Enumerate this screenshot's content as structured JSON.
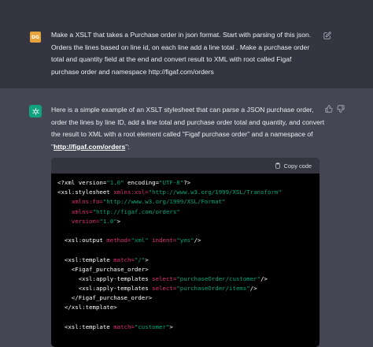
{
  "user_message": {
    "avatar_initials": "DG",
    "avatar_color": "#e6a23c",
    "text": "Make a XSLT  that takes a Purchase order in json format. Start with parsing of this json. Orders the lines based on line id, on each line add a line total . Make a purchase order total and quantity field at the end and convert result to XML with root called Figaf purchase order and namespace http://figaf.com/orders"
  },
  "assistant_message": {
    "avatar_icon": "openai-logo-icon",
    "avatar_color": "#10a37f",
    "intro_text": "Here is a simple example of an XSLT stylesheet that can parse a JSON purchase order, order the lines by line ID, add a line total and purchase order total and quantity, and convert the result to XML with a root element called \"Figaf purchase order\" and a namespace of \"",
    "link_text": "http://figaf.com/orders",
    "intro_suffix": "\":"
  },
  "code_block": {
    "copy_label": "Copy code",
    "lines": [
      [
        {
          "t": "<?xml version=",
          "c": "plain"
        },
        {
          "t": "\"1.0\"",
          "c": "val"
        },
        {
          "t": " encoding=",
          "c": "plain"
        },
        {
          "t": "\"UTF-8\"",
          "c": "val"
        },
        {
          "t": "?>",
          "c": "plain"
        }
      ],
      [
        {
          "t": "<xsl:stylesheet ",
          "c": "tag"
        },
        {
          "t": "xmlns:xsl=",
          "c": "attr"
        },
        {
          "t": "\"http://www.w3.org/1999/XSL/Transform\"",
          "c": "val"
        }
      ],
      [
        {
          "t": "    ",
          "c": "plain"
        },
        {
          "t": "xmlns:fo=",
          "c": "attr"
        },
        {
          "t": "\"http://www.w3.org/1999/XSL/Format\"",
          "c": "val"
        }
      ],
      [
        {
          "t": "    ",
          "c": "plain"
        },
        {
          "t": "xmlns=",
          "c": "attr"
        },
        {
          "t": "\"http://figaf.com/orders\"",
          "c": "val"
        }
      ],
      [
        {
          "t": "    ",
          "c": "plain"
        },
        {
          "t": "version=",
          "c": "attr"
        },
        {
          "t": "\"1.0\"",
          "c": "val"
        },
        {
          "t": ">",
          "c": "tag"
        }
      ],
      [
        {
          "t": "",
          "c": "plain"
        }
      ],
      [
        {
          "t": "  <xsl:output ",
          "c": "tag"
        },
        {
          "t": "method=",
          "c": "attr"
        },
        {
          "t": "\"xml\"",
          "c": "val"
        },
        {
          "t": " ",
          "c": "plain"
        },
        {
          "t": "indent=",
          "c": "attr"
        },
        {
          "t": "\"yes\"",
          "c": "val"
        },
        {
          "t": "/>",
          "c": "tag"
        }
      ],
      [
        {
          "t": "",
          "c": "plain"
        }
      ],
      [
        {
          "t": "  <xsl:template ",
          "c": "tag"
        },
        {
          "t": "match=",
          "c": "attr"
        },
        {
          "t": "\"/\"",
          "c": "val"
        },
        {
          "t": ">",
          "c": "tag"
        }
      ],
      [
        {
          "t": "    <Figaf_purchase_order>",
          "c": "tag"
        }
      ],
      [
        {
          "t": "      <xsl:apply-templates ",
          "c": "tag"
        },
        {
          "t": "select=",
          "c": "attr"
        },
        {
          "t": "\"purchaseOrder/customer\"",
          "c": "val"
        },
        {
          "t": "/>",
          "c": "tag"
        }
      ],
      [
        {
          "t": "      <xsl:apply-templates ",
          "c": "tag"
        },
        {
          "t": "select=",
          "c": "attr"
        },
        {
          "t": "\"purchaseOrder/items\"",
          "c": "val"
        },
        {
          "t": "/>",
          "c": "tag"
        }
      ],
      [
        {
          "t": "    </Figaf_purchase_order>",
          "c": "tag"
        }
      ],
      [
        {
          "t": "  </xsl:template>",
          "c": "tag"
        }
      ],
      [
        {
          "t": "",
          "c": "plain"
        }
      ],
      [
        {
          "t": "  <xsl:template ",
          "c": "tag"
        },
        {
          "t": "match=",
          "c": "attr"
        },
        {
          "t": "\"customer\"",
          "c": "val"
        },
        {
          "t": ">",
          "c": "tag"
        }
      ]
    ]
  }
}
